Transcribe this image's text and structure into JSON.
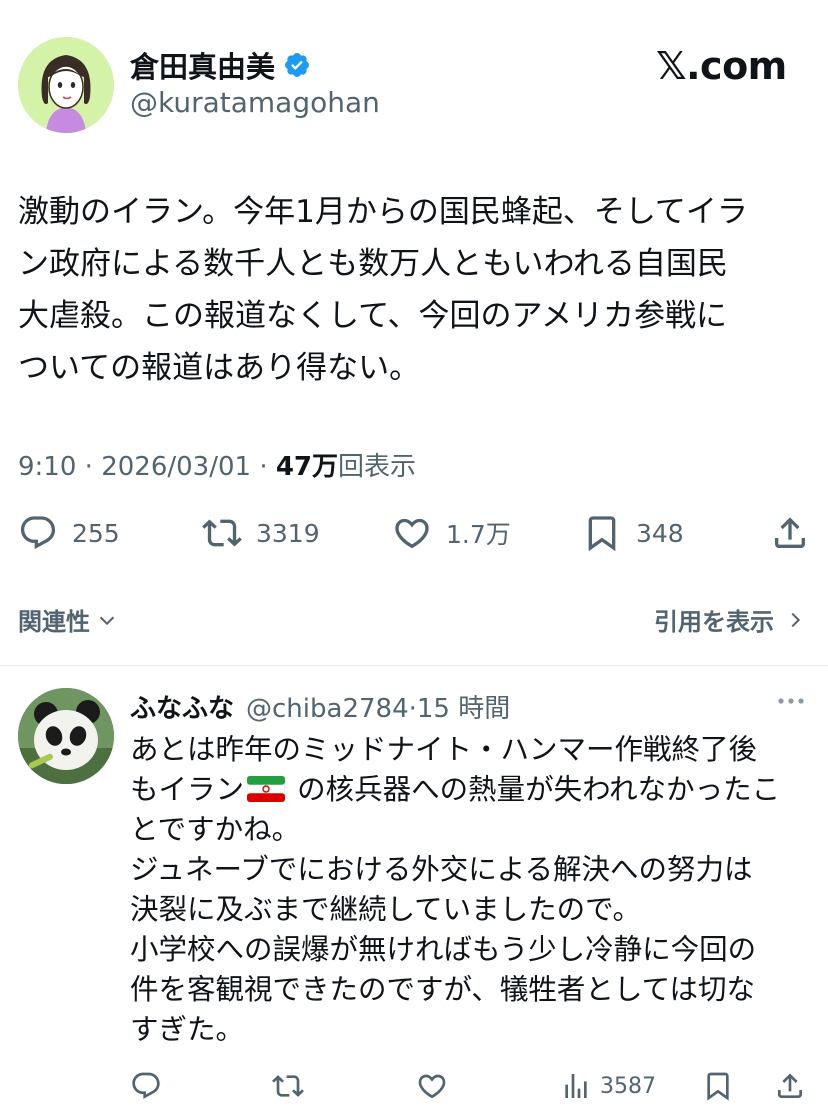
{
  "author": {
    "name": "倉田真由美",
    "handle": "@kuratamagohan",
    "verified": true,
    "avatar_icon": "cartoon-woman-avatar"
  },
  "site_label": "𝕏.com",
  "tweet": {
    "text": "激動のイラン。今年1月からの国民蜂起、そしてイラ\nン政府による数千人とも数万人ともいわれる自国民\n大虐殺。この報道なくして、今回のアメリカ参戦に\nついての報道はあり得ない。",
    "time": "9:10",
    "date": "2026/03/01",
    "views_count": "47万",
    "views_label": "回表示"
  },
  "actions": {
    "replies": "255",
    "reposts": "3319",
    "likes": "1.7万",
    "bookmarks": "348"
  },
  "footer": {
    "related_label": "関連性",
    "quotes_label": "引用を表示"
  },
  "reply": {
    "name": "ふなふな",
    "handle": "@chiba2784",
    "time": "15 時間",
    "text_before_flag": "あとは昨年のミッドナイト・ハンマー作戦終了後\nもイラン",
    "text_after_flag": " の核兵器への熱量が失われなかったこ\nとですかね。\nジュネーブでにおける外交による解決への努力は\n決裂に及ぶまで継続していましたので。\n小学校への誤爆が無ければもう少し冷静に今回の\n件を客観視できたのですが、犠牲者としては切な\nすぎた。",
    "views": "3587",
    "avatar_icon": "panda-avatar"
  },
  "colors": {
    "text": "#0f1419",
    "secondary": "#536471",
    "verified_blue": "#1d9bf0",
    "divider": "#e6ecf0"
  }
}
